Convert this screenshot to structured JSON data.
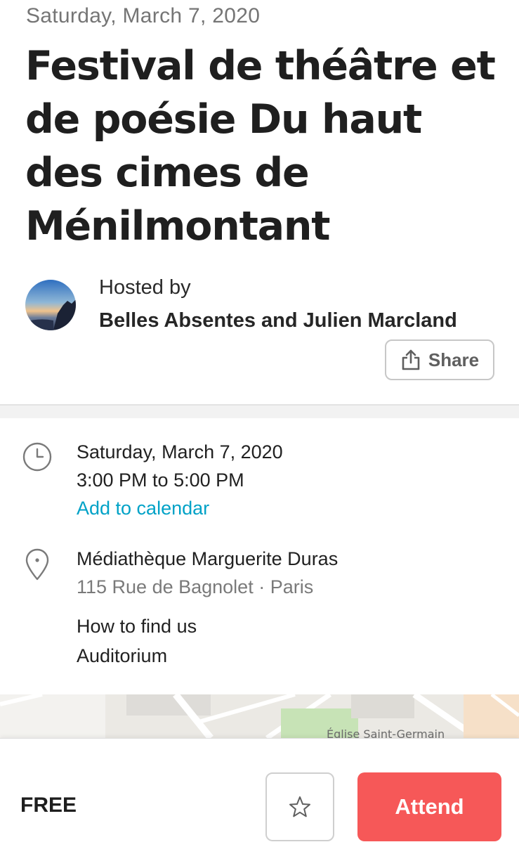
{
  "event": {
    "date_header": "Saturday, March 7, 2020",
    "title_lines": [
      "Festival de théâtre et",
      "de poésie Du haut",
      "des cimes de",
      "Ménilmontant"
    ]
  },
  "host": {
    "label": "Hosted by",
    "names": "Belles Absentes and Julien Marcland",
    "avatar_icon": "landscape-avatar"
  },
  "share": {
    "label": "Share",
    "icon": "share-icon"
  },
  "datetime": {
    "icon": "clock-icon",
    "date": "Saturday, March 7, 2020",
    "time": "3:00 PM to 5:00 PM",
    "add_calendar": "Add to calendar"
  },
  "location": {
    "icon": "map-pin-icon",
    "venue": "Médiathèque Marguerite Duras",
    "address": "115 Rue de Bagnolet · Paris",
    "how_to_find_label": "How to find us",
    "how_to_find_value": "Auditorium",
    "map_label": "Église Saint-Germain"
  },
  "bottom_bar": {
    "price": "FREE",
    "save_icon": "star-icon",
    "attend_label": "Attend"
  },
  "colors": {
    "accent_link": "#00a2c7",
    "attend_button": "#f65858",
    "muted_text": "#757575"
  }
}
